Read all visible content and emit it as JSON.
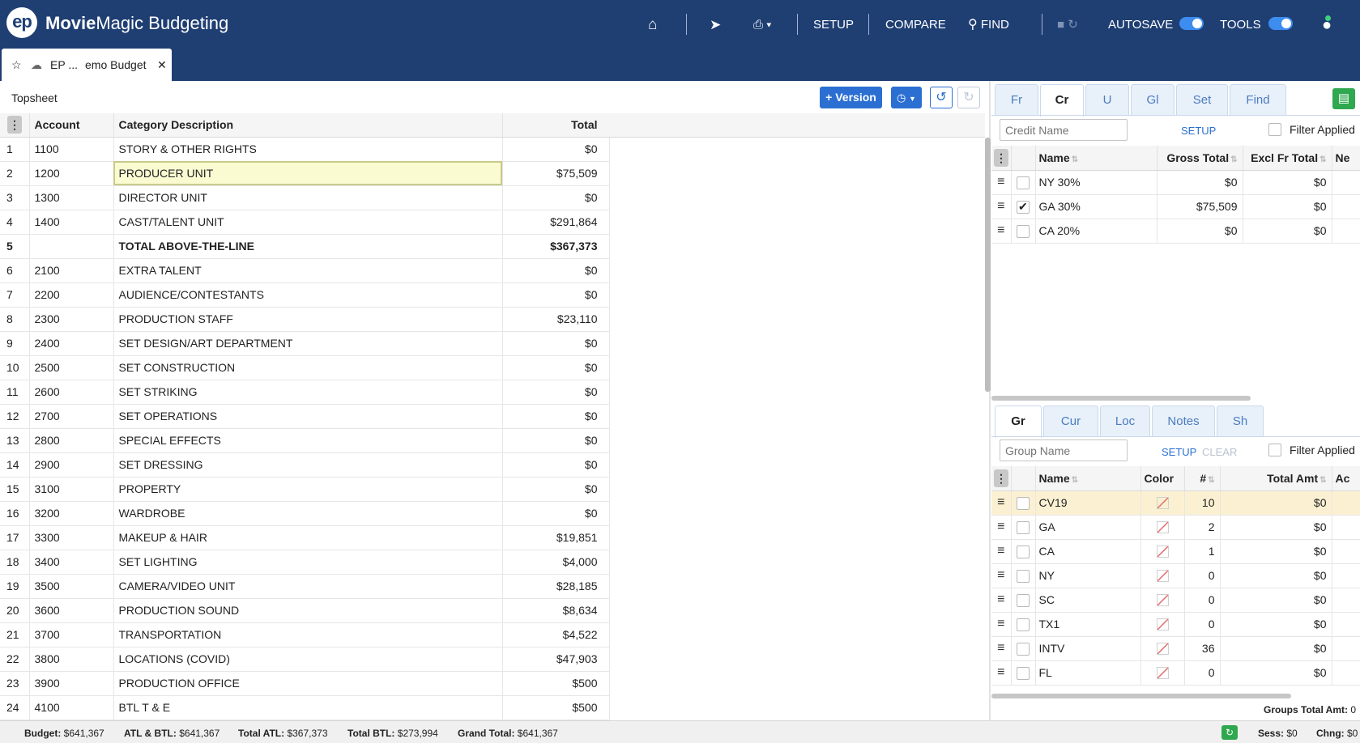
{
  "app": {
    "logo_text": "ep",
    "name_bold": "Movie",
    "name_rest": "Magic Budgeting"
  },
  "toolbar": {
    "setup": "SETUP",
    "compare": "COMPARE",
    "find": "FIND",
    "autosave": "AUTOSAVE",
    "tools": "TOOLS"
  },
  "document_tab": {
    "label_left": "EP ...",
    "label_right": "emo Budget",
    "close": "✕"
  },
  "topsheet": {
    "title": "Topsheet",
    "version_button": "+ Version",
    "columns": [
      "Account",
      "Category Description",
      "Total"
    ],
    "rows": [
      {
        "n": "1",
        "account": "1100",
        "desc": "STORY & OTHER RIGHTS",
        "total": "$0"
      },
      {
        "n": "2",
        "account": "1200",
        "desc": "PRODUCER UNIT",
        "total": "$75,509"
      },
      {
        "n": "3",
        "account": "1300",
        "desc": "DIRECTOR UNIT",
        "total": "$0"
      },
      {
        "n": "4",
        "account": "1400",
        "desc": "CAST/TALENT UNIT",
        "total": "$291,864"
      },
      {
        "n": "5",
        "account": "",
        "desc": "TOTAL ABOVE-THE-LINE",
        "total": "$367,373"
      },
      {
        "n": "6",
        "account": "2100",
        "desc": "EXTRA TALENT",
        "total": "$0"
      },
      {
        "n": "7",
        "account": "2200",
        "desc": "AUDIENCE/CONTESTANTS",
        "total": "$0"
      },
      {
        "n": "8",
        "account": "2300",
        "desc": "PRODUCTION STAFF",
        "total": "$23,110"
      },
      {
        "n": "9",
        "account": "2400",
        "desc": "SET DESIGN/ART DEPARTMENT",
        "total": "$0"
      },
      {
        "n": "10",
        "account": "2500",
        "desc": "SET CONSTRUCTION",
        "total": "$0"
      },
      {
        "n": "11",
        "account": "2600",
        "desc": "SET STRIKING",
        "total": "$0"
      },
      {
        "n": "12",
        "account": "2700",
        "desc": "SET OPERATIONS",
        "total": "$0"
      },
      {
        "n": "13",
        "account": "2800",
        "desc": "SPECIAL EFFECTS",
        "total": "$0"
      },
      {
        "n": "14",
        "account": "2900",
        "desc": "SET DRESSING",
        "total": "$0"
      },
      {
        "n": "15",
        "account": "3100",
        "desc": "PROPERTY",
        "total": "$0"
      },
      {
        "n": "16",
        "account": "3200",
        "desc": "WARDROBE",
        "total": "$0"
      },
      {
        "n": "17",
        "account": "3300",
        "desc": "MAKEUP & HAIR",
        "total": "$19,851"
      },
      {
        "n": "18",
        "account": "3400",
        "desc": "SET LIGHTING",
        "total": "$4,000"
      },
      {
        "n": "19",
        "account": "3500",
        "desc": "CAMERA/VIDEO UNIT",
        "total": "$28,185"
      },
      {
        "n": "20",
        "account": "3600",
        "desc": "PRODUCTION SOUND",
        "total": "$8,634"
      },
      {
        "n": "21",
        "account": "3700",
        "desc": "TRANSPORTATION",
        "total": "$4,522"
      },
      {
        "n": "22",
        "account": "3800",
        "desc": "LOCATIONS (COVID)",
        "total": "$47,903"
      },
      {
        "n": "23",
        "account": "3900",
        "desc": "PRODUCTION OFFICE",
        "total": "$500"
      },
      {
        "n": "24",
        "account": "4100",
        "desc": "BTL T & E",
        "total": "$500"
      }
    ]
  },
  "credits_panel": {
    "tabs": [
      "Fr",
      "Cr",
      "U",
      "Gl",
      "Set",
      "Find"
    ],
    "search_placeholder": "Credit Name",
    "setup": "SETUP",
    "filter_label": "Filter Applied",
    "columns": [
      "Name",
      "Gross Total",
      "Excl Fr Total",
      "Ne"
    ],
    "rows": [
      {
        "name": "NY 30%",
        "gross": "$0",
        "excl": "$0",
        "checked": false
      },
      {
        "name": "GA 30%",
        "gross": "$75,509",
        "excl": "$0",
        "checked": true
      },
      {
        "name": "CA 20%",
        "gross": "$0",
        "excl": "$0",
        "checked": false
      }
    ]
  },
  "groups_panel": {
    "tabs": [
      "Gr",
      "Cur",
      "Loc",
      "Notes",
      "Sh"
    ],
    "search_placeholder": "Group Name",
    "setup": "SETUP",
    "clear": "CLEAR",
    "filter_label": "Filter Applied",
    "columns": [
      "Name",
      "Color",
      "#",
      "Total Amt",
      "Ac"
    ],
    "rows": [
      {
        "name": "CV19",
        "count": "10",
        "total": "$0"
      },
      {
        "name": "GA",
        "count": "2",
        "total": "$0"
      },
      {
        "name": "CA",
        "count": "1",
        "total": "$0"
      },
      {
        "name": "NY",
        "count": "0",
        "total": "$0"
      },
      {
        "name": "SC",
        "count": "0",
        "total": "$0"
      },
      {
        "name": "TX1",
        "count": "0",
        "total": "$0"
      },
      {
        "name": "INTV",
        "count": "36",
        "total": "$0"
      },
      {
        "name": "FL",
        "count": "0",
        "total": "$0"
      }
    ],
    "total_label": "Groups Total Amt:",
    "total_value": "0"
  },
  "status": {
    "budget_label": "Budget:",
    "budget": "$641,367",
    "atlbtl_label": "ATL & BTL:",
    "atlbtl": "$641,367",
    "atl_label": "Total ATL:",
    "atl": "$367,373",
    "btl_label": "Total BTL:",
    "btl": "$273,994",
    "grand_label": "Grand Total:",
    "grand": "$641,367",
    "sess_label": "Sess:",
    "sess": "$0",
    "chng_label": "Chng:",
    "chng": "$0"
  },
  "colors": {
    "header_bg": "#1f3f73",
    "accent": "#2b6fd2",
    "selected_cell": "#fbfbd2",
    "highlight_row": "#fbf1d2",
    "refresh_green": "#2fa84f"
  }
}
